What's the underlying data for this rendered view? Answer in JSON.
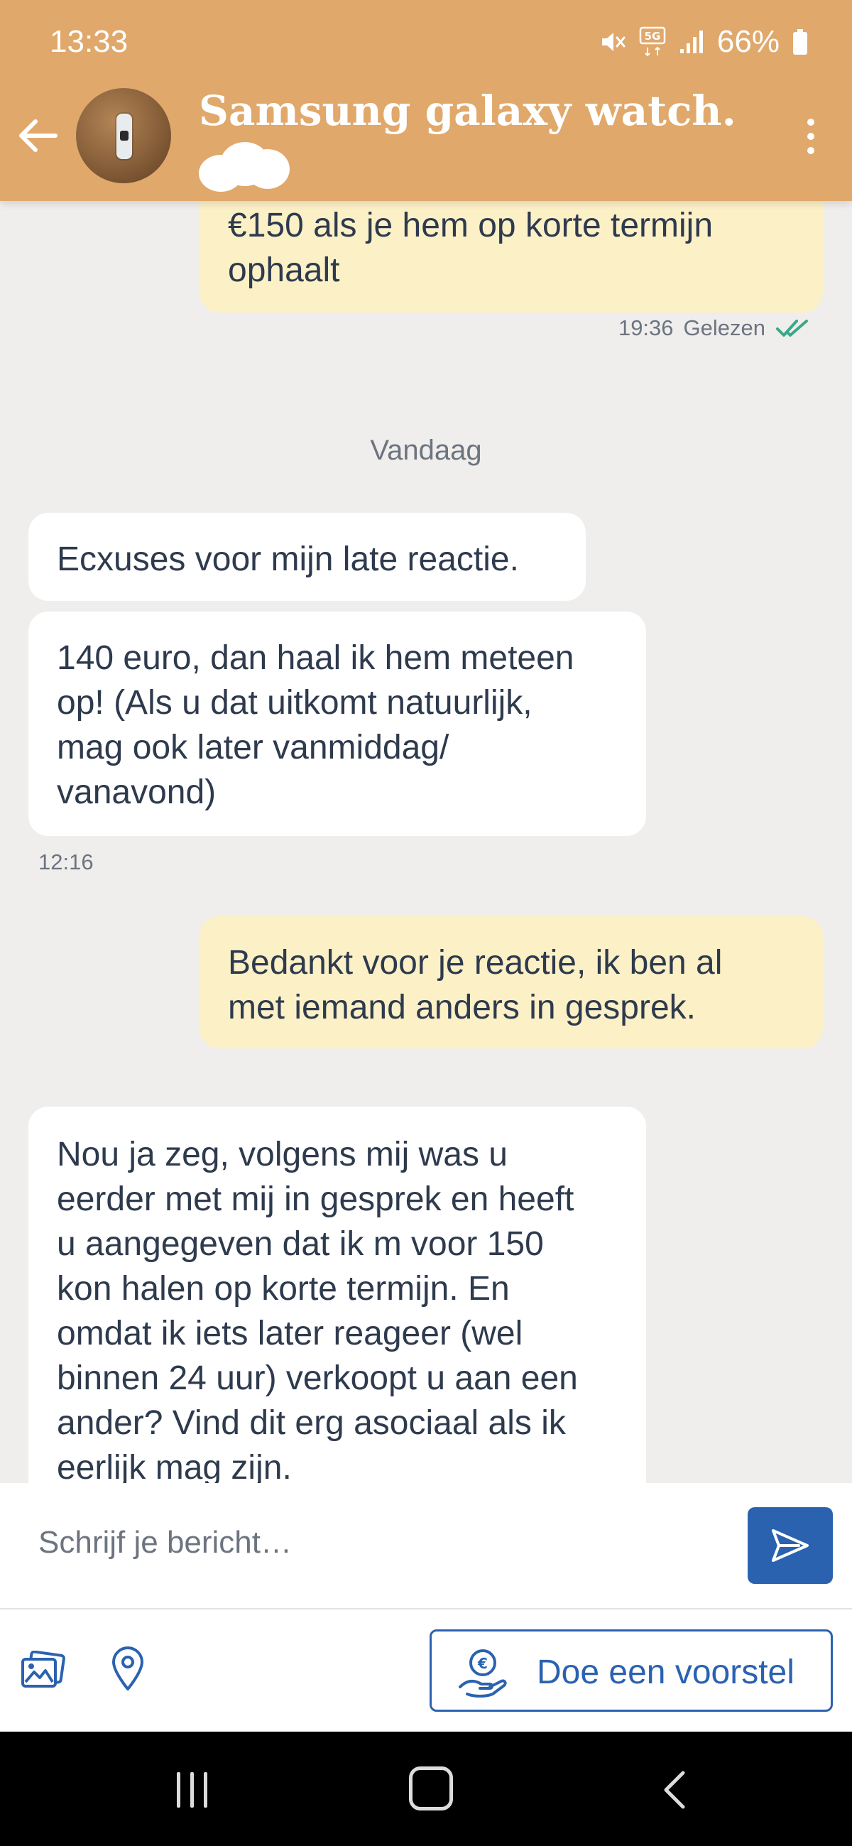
{
  "status_bar": {
    "time": "13:33",
    "battery": "66%",
    "icons": [
      "mute-icon",
      "5g-icon",
      "signal-icon",
      "battery-icon"
    ]
  },
  "header": {
    "title": "Samsung galaxy watch…",
    "avatar": "watch-listing-photo",
    "back_icon": "arrow-left-icon",
    "more_icon": "more-vertical-icon"
  },
  "messages": [
    {
      "direction": "outgoing",
      "text": "€150 als je hem op korte termijn\nophaalt",
      "time": "19:36",
      "status": "Gelezen"
    },
    {
      "direction": "separator",
      "text": "Vandaag"
    },
    {
      "direction": "incoming",
      "text": "Ecxuses voor mijn late reactie."
    },
    {
      "direction": "incoming",
      "text": "140 euro, dan haal ik hem meteen\nop! (Als u dat uitkomt natuurlijk,\nmag ook later vanmiddag/\nvanavond)",
      "time": "12:16"
    },
    {
      "direction": "outgoing",
      "text": "Bedankt voor je reactie, ik ben al\nmet iemand anders in gesprek."
    },
    {
      "direction": "incoming",
      "text": "Nou ja zeg, volgens mij was u\neerder met mij in gesprek en heeft\nu aangegeven dat ik m voor 150\nkon halen op korte termijn. En\nomdat ik iets later reageer (wel\nbinnen 24 uur) verkoopt u aan een\nander? Vind dit erg asociaal als ik\neerlijk mag zijn."
    }
  ],
  "composer": {
    "placeholder": "Schrijf je bericht…",
    "value": "",
    "send_icon": "send-icon"
  },
  "actions": {
    "gallery_icon": "gallery-icon",
    "location_icon": "location-pin-icon",
    "offer_label": "Doe een voorstel",
    "offer_icon": "euro-hand-icon"
  },
  "colors": {
    "header_bg": "#e0a86b",
    "outgoing_bubble": "#fcf0c6",
    "incoming_bubble": "#ffffff",
    "chat_bg": "#efeeec",
    "accent_blue": "#2a62b0",
    "read_check": "#3aa889"
  }
}
